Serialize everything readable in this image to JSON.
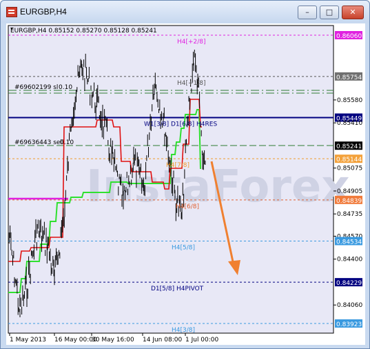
{
  "window": {
    "title": "EURGBP,H4",
    "buttons": {
      "minimize": "–",
      "maximize": "□",
      "close": "✕"
    }
  },
  "chart": {
    "info_line": "EURGBP,H4  0.85152 0.85270 0.85128 0.85241",
    "background": "#e8e8f6",
    "price_scale": [
      "0.86060",
      "0.85754",
      "0.85580",
      "0.85449",
      "0.85410",
      "0.85241",
      "0.85144",
      "0.85075",
      "0.84905",
      "0.84839",
      "0.84735",
      "0.84570",
      "0.84534",
      "0.84400",
      "0.84229",
      "0.84060",
      "0.83923"
    ],
    "time_labels": [
      "1 May 2013",
      "16 May 00:00",
      "30 May 16:00",
      "14 Jun 08:00",
      "1 Jul 00:00"
    ],
    "watermark": "InstaForex",
    "orders": {
      "sell1": "#69602199 sl",
      "sell1_lots": "0.10",
      "sell2": "#69636443 sell",
      "sell2_lots": "0.10"
    },
    "levels": [
      {
        "label": "H4[+2/8]",
        "price": 0.8606,
        "color": "#e020e0"
      },
      {
        "label": "H4[+1/8]",
        "price": 0.85754,
        "color": "#555555"
      },
      {
        "label": "W1[3/8] D1[6/8] H4RES",
        "price": 0.85449,
        "color": "#000080"
      },
      {
        "label": "H4[7/8]",
        "price": 0.85144,
        "color": "#f39a2a"
      },
      {
        "label": "H4[6/8]",
        "price": 0.84839,
        "color": "#e06030"
      },
      {
        "label": "H4[5/8]",
        "price": 0.84534,
        "color": "#3a9ae0"
      },
      {
        "label": "D1[5/8] H4PIVOT",
        "price": 0.84229,
        "color": "#000080"
      },
      {
        "label": "H4[3/8]",
        "price": 0.83923,
        "color": "#3a9ae0"
      }
    ],
    "current_price": "0.85241",
    "arrow_color": "#f08030"
  }
}
